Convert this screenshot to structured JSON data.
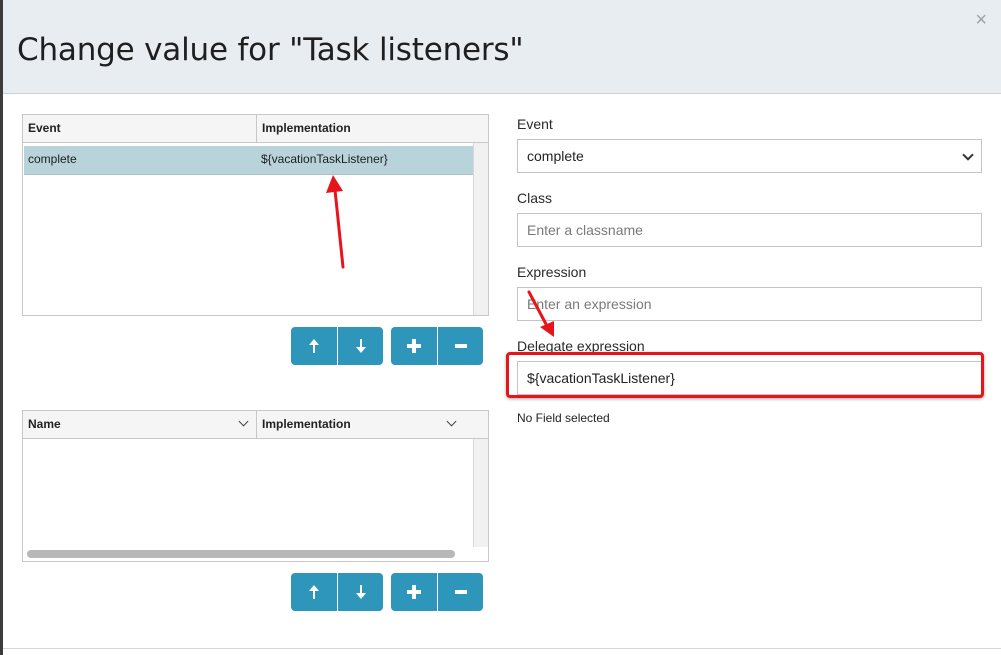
{
  "dialog": {
    "title": "Change value for \"Task listeners\"",
    "close_symbol": "×"
  },
  "listeners_grid": {
    "columns": [
      "Event",
      "Implementation"
    ],
    "rows": [
      {
        "event": "complete",
        "implementation": "${vacationTaskListener}",
        "selected": true
      }
    ]
  },
  "fields_grid": {
    "columns": [
      "Name",
      "Implementation"
    ]
  },
  "buttons": {
    "move_up_icon": "arrow-up-icon",
    "move_down_icon": "arrow-down-icon",
    "add_icon": "plus-icon",
    "remove_icon": "minus-icon"
  },
  "form": {
    "event_label": "Event",
    "event_value": "complete",
    "class_label": "Class",
    "class_placeholder": "Enter a classname",
    "expression_label": "Expression",
    "expression_placeholder": "Enter an expression",
    "delegate_label": "Delegate expression",
    "delegate_value": "${vacationTaskListener}"
  },
  "status": {
    "no_field": "No Field selected"
  },
  "colors": {
    "accent_button": "#2e95bb",
    "selected_row": "#b9d3da",
    "annotation_red": "#e8141b",
    "header_bg": "#e8edf1"
  }
}
